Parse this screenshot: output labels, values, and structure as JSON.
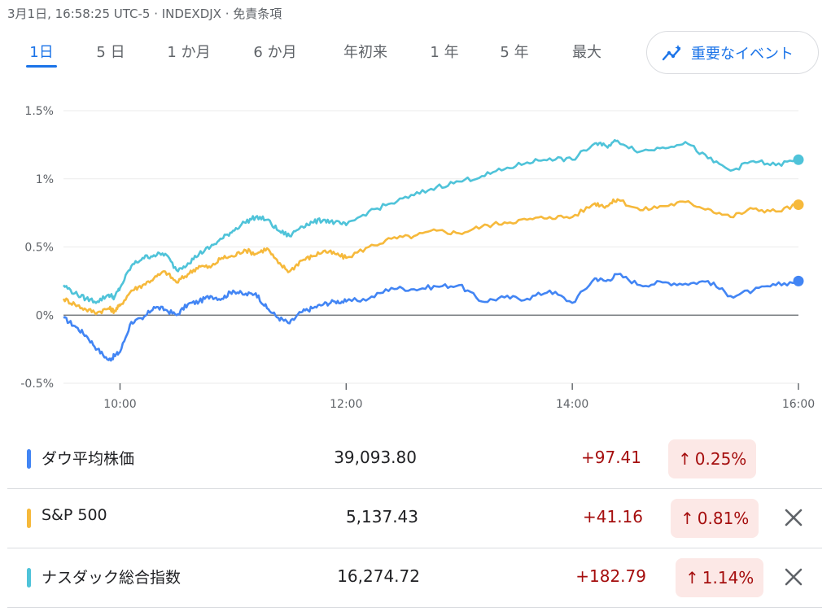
{
  "header": {
    "meta": "3月1日, 16:58:25 UTC-5 · INDEXDJX · 免責条項"
  },
  "tabs": [
    {
      "label": "1日",
      "active": true
    },
    {
      "label": "5 日"
    },
    {
      "label": "1 か月"
    },
    {
      "label": "6 か月"
    },
    {
      "label": "年初来"
    },
    {
      "label": "1 年"
    },
    {
      "label": "5 年"
    },
    {
      "label": "最大"
    }
  ],
  "events_button": {
    "label": "重要なイベント",
    "icon": "trend-sparkle-icon"
  },
  "colors": {
    "dow": "#4285f4",
    "sp500": "#f6b93b",
    "nasdaq": "#4fc3d9",
    "positive": "#a50e0e",
    "positive_bg": "#fce8e6",
    "accent": "#1a73e8"
  },
  "chart_data": {
    "type": "line",
    "ylim": [
      -0.5,
      1.5
    ],
    "xlim": [
      9.5,
      16.0
    ],
    "yticks": [
      -0.5,
      0,
      0.5,
      1,
      1.5
    ],
    "ytick_labels": [
      "-0.5%",
      "0%",
      "0.5%",
      "1%",
      "1.5%"
    ],
    "xticks": [
      10,
      12,
      14,
      16
    ],
    "xtick_labels": [
      "10:00",
      "12:00",
      "14:00",
      "16:00"
    ],
    "baseline": 0,
    "series": [
      {
        "name": "ダウ平均株価",
        "color": "#4285f4",
        "x": [
          9.5,
          9.6,
          9.7,
          9.8,
          9.9,
          9.95,
          10.0,
          10.1,
          10.2,
          10.3,
          10.4,
          10.5,
          10.6,
          10.7,
          10.8,
          10.9,
          11.0,
          11.1,
          11.2,
          11.3,
          11.4,
          11.5,
          11.6,
          11.7,
          11.8,
          11.9,
          12.0,
          12.2,
          12.4,
          12.6,
          12.8,
          13.0,
          13.2,
          13.4,
          13.6,
          13.8,
          14.0,
          14.2,
          14.3,
          14.4,
          14.6,
          14.8,
          15.0,
          15.2,
          15.4,
          15.6,
          15.8,
          16.0
        ],
        "y": [
          -0.02,
          -0.08,
          -0.15,
          -0.25,
          -0.33,
          -0.3,
          -0.27,
          -0.05,
          -0.03,
          0.06,
          0.04,
          0.0,
          0.08,
          0.1,
          0.14,
          0.12,
          0.18,
          0.15,
          0.16,
          0.05,
          -0.02,
          -0.06,
          0.02,
          0.05,
          0.08,
          0.1,
          0.1,
          0.12,
          0.2,
          0.19,
          0.21,
          0.22,
          0.1,
          0.13,
          0.12,
          0.18,
          0.09,
          0.27,
          0.25,
          0.3,
          0.22,
          0.24,
          0.23,
          0.25,
          0.14,
          0.18,
          0.22,
          0.25
        ]
      },
      {
        "name": "S&P 500",
        "color": "#f6b93b",
        "x": [
          9.5,
          9.6,
          9.7,
          9.8,
          9.9,
          9.95,
          10.0,
          10.1,
          10.2,
          10.3,
          10.4,
          10.5,
          10.6,
          10.7,
          10.8,
          10.9,
          11.0,
          11.1,
          11.2,
          11.3,
          11.4,
          11.5,
          11.6,
          11.7,
          11.8,
          11.9,
          12.0,
          12.2,
          12.4,
          12.6,
          12.8,
          13.0,
          13.2,
          13.4,
          13.6,
          13.8,
          14.0,
          14.2,
          14.3,
          14.4,
          14.6,
          14.8,
          15.0,
          15.2,
          15.4,
          15.6,
          15.8,
          16.0
        ],
        "y": [
          0.12,
          0.08,
          0.04,
          0.02,
          0.05,
          0.03,
          0.07,
          0.18,
          0.22,
          0.27,
          0.32,
          0.24,
          0.3,
          0.36,
          0.35,
          0.42,
          0.43,
          0.48,
          0.45,
          0.49,
          0.38,
          0.32,
          0.4,
          0.43,
          0.47,
          0.45,
          0.42,
          0.5,
          0.56,
          0.58,
          0.62,
          0.6,
          0.65,
          0.68,
          0.7,
          0.72,
          0.72,
          0.82,
          0.8,
          0.85,
          0.77,
          0.8,
          0.83,
          0.78,
          0.72,
          0.78,
          0.76,
          0.81
        ]
      },
      {
        "name": "ナスダック総合指数",
        "color": "#4fc3d9",
        "x": [
          9.5,
          9.6,
          9.7,
          9.8,
          9.9,
          9.95,
          10.0,
          10.1,
          10.2,
          10.3,
          10.4,
          10.5,
          10.6,
          10.7,
          10.8,
          10.9,
          11.0,
          11.1,
          11.2,
          11.3,
          11.4,
          11.5,
          11.6,
          11.7,
          11.8,
          11.9,
          12.0,
          12.2,
          12.4,
          12.6,
          12.8,
          13.0,
          13.2,
          13.4,
          13.6,
          13.8,
          14.0,
          14.2,
          14.3,
          14.4,
          14.6,
          14.8,
          15.0,
          15.2,
          15.4,
          15.6,
          15.8,
          16.0
        ],
        "y": [
          0.22,
          0.16,
          0.12,
          0.1,
          0.15,
          0.13,
          0.2,
          0.36,
          0.42,
          0.44,
          0.45,
          0.33,
          0.38,
          0.45,
          0.5,
          0.56,
          0.62,
          0.68,
          0.72,
          0.7,
          0.62,
          0.58,
          0.65,
          0.68,
          0.7,
          0.68,
          0.66,
          0.76,
          0.82,
          0.88,
          0.94,
          0.98,
          1.02,
          1.07,
          1.12,
          1.15,
          1.14,
          1.26,
          1.24,
          1.28,
          1.2,
          1.23,
          1.27,
          1.15,
          1.06,
          1.13,
          1.1,
          1.14
        ]
      }
    ]
  },
  "rows": [
    {
      "name": "ダウ平均株価",
      "value": "39,093.80",
      "change": "+97.41",
      "pct": "0.25%",
      "arrow": "↑",
      "color": "#4285f4",
      "removable": false
    },
    {
      "name": "S&P 500",
      "value": "5,137.43",
      "change": "+41.16",
      "pct": "0.81%",
      "arrow": "↑",
      "color": "#f6b93b",
      "removable": true
    },
    {
      "name": "ナスダック総合指数",
      "value": "16,274.72",
      "change": "+182.79",
      "pct": "1.14%",
      "arrow": "↑",
      "color": "#4fc3d9",
      "removable": true
    }
  ]
}
